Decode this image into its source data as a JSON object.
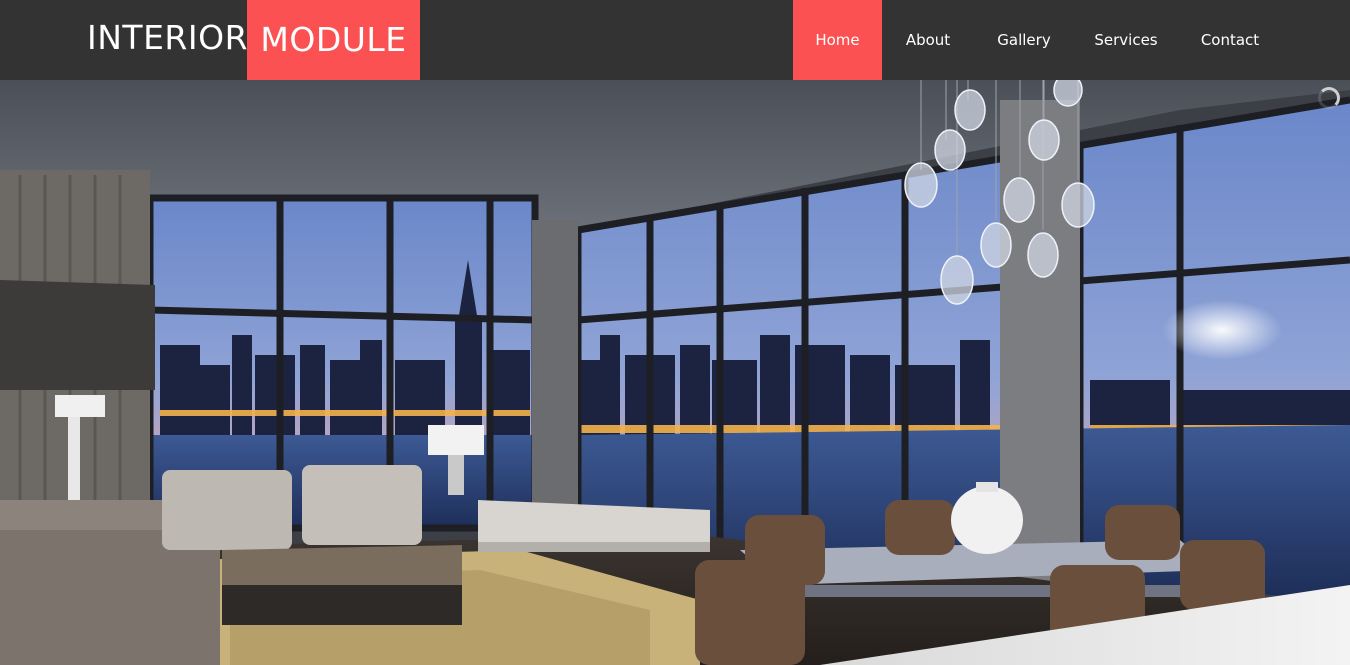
{
  "brand": {
    "part1": "INTERIOR",
    "part2": "MODULE",
    "accent_color": "#fb5152"
  },
  "nav": {
    "items": [
      {
        "label": "Home",
        "active": true
      },
      {
        "label": "About",
        "active": false
      },
      {
        "label": "Gallery",
        "active": false
      },
      {
        "label": "Services",
        "active": false
      },
      {
        "label": "Contact",
        "active": false
      }
    ]
  },
  "hero": {
    "icon": "loading-spinner-icon"
  }
}
